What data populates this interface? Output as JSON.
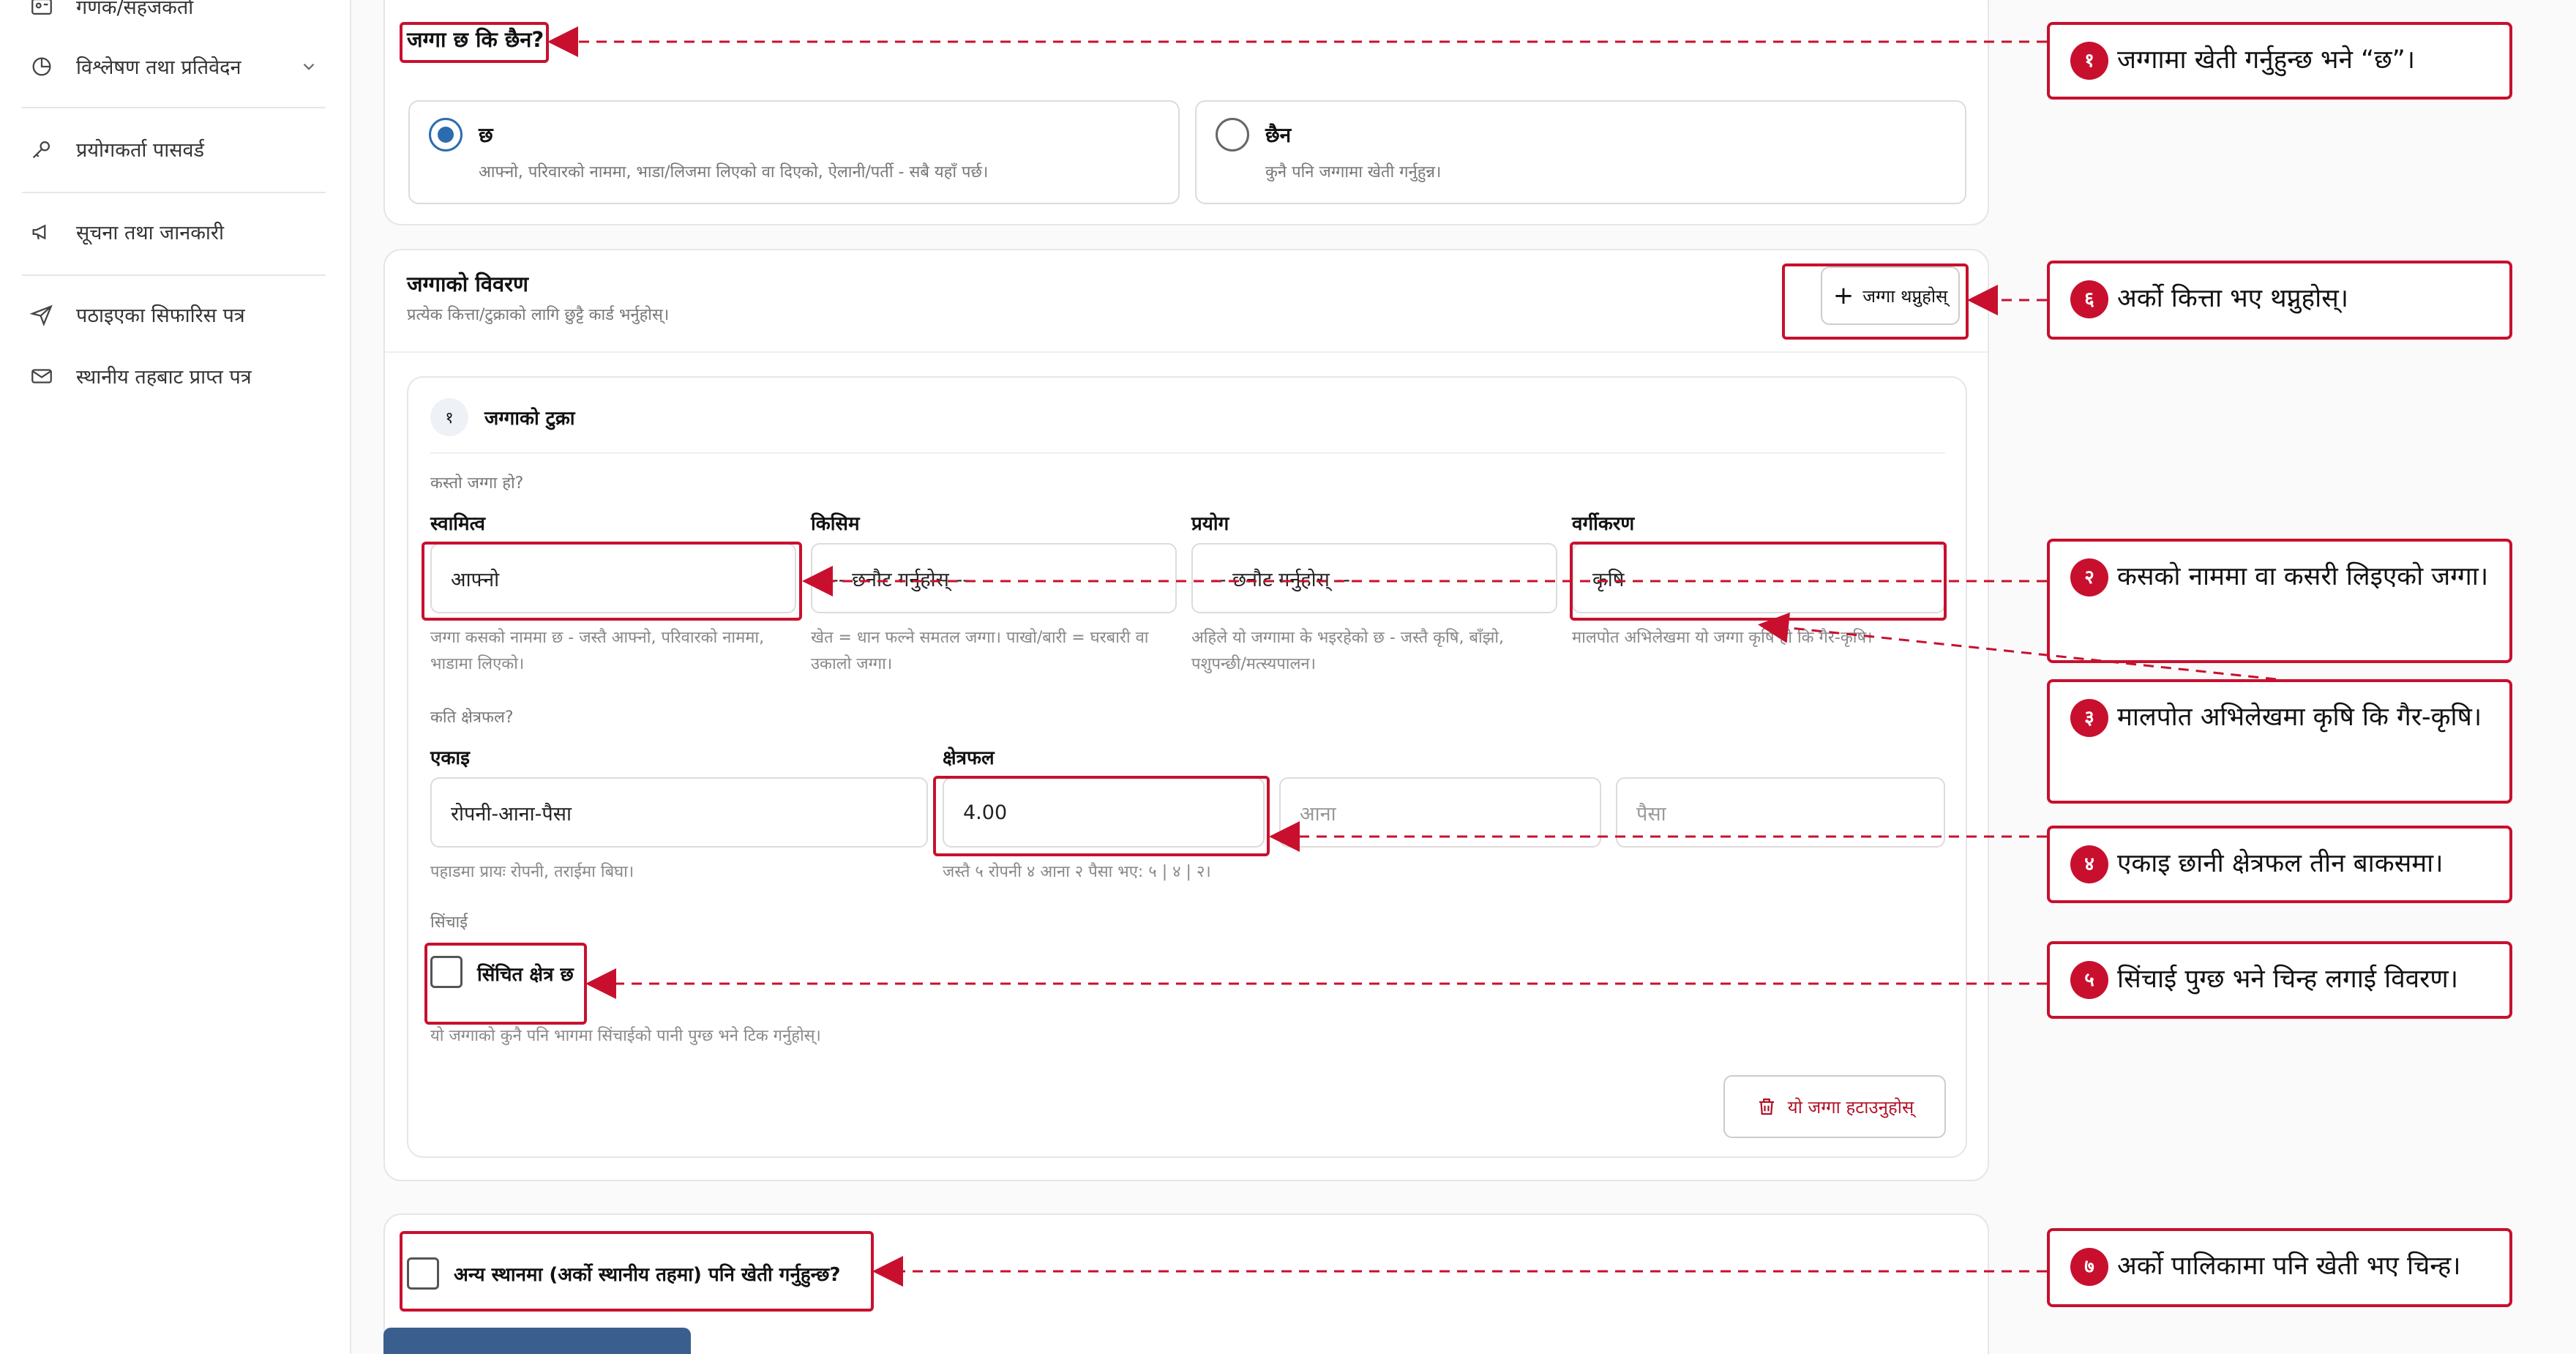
{
  "sidebar": {
    "items": [
      {
        "label": "गणक/सहजकर्ता",
        "icon": "id-card-icon"
      },
      {
        "label": "विश्लेषण तथा प्रतिवेदन",
        "icon": "pie-chart-icon"
      },
      {
        "label": "प्रयोगकर्ता पासवर्ड",
        "icon": "key-icon"
      },
      {
        "label": "सूचना तथा जानकारी",
        "icon": "megaphone-icon"
      },
      {
        "label": "पठाइएका सिफारिस पत्र",
        "icon": "send-icon"
      },
      {
        "label": "स्थानीय तहबाट प्राप्त पत्र",
        "icon": "mail-icon"
      }
    ]
  },
  "land_question": {
    "title": "जग्गा छ कि छैन?",
    "options": [
      {
        "label": "छ",
        "desc": "आफ्नो, परिवारको नाममा, भाडा/लिजमा लिएको वा दिएको, ऐलानी/पर्ती - सबै यहाँ पर्छ।",
        "selected": true
      },
      {
        "label": "छैन",
        "desc": "कुनै पनि जग्गामा खेती गर्नुहुन्न।",
        "selected": false
      }
    ]
  },
  "land_details": {
    "title": "जग्गाको विवरण",
    "subtitle": "प्रत्येक कित्ता/टुक्राको लागि छुट्टै कार्ड भर्नुहोस्।",
    "add_button": "जग्गा थप्नुहोस्",
    "parcel": {
      "index": "१",
      "title": "जग्गाको टुक्रा",
      "what_land": "कस्तो जग्गा हो?",
      "fields": [
        {
          "label": "स्वामित्व",
          "value": "आफ्नो",
          "help": "जग्गा कसको नाममा छ - जस्तै आफ्नो, परिवारको नाममा, भाडामा लिएको।"
        },
        {
          "label": "किसिम",
          "value": "-- छनौट गर्नुहोस् --",
          "help": "खेत = धान फल्ने समतल जग्गा। पाखो/बारी = घरबारी वा उकालो जग्गा।"
        },
        {
          "label": "प्रयोग",
          "value": "-- छनौट गर्नुहोस् --",
          "help": "अहिले यो जग्गामा के भइरहेको छ - जस्तै कृषि, बाँझो, पशुपन्छी/मत्स्यपालन।"
        },
        {
          "label": "वर्गीकरण",
          "value": "कृषि",
          "help": "मालपोत अभिलेखमा यो जग्गा कृषि हो कि गैर-कृषि।"
        }
      ],
      "area_question": "कति क्षेत्रफल?",
      "unit": {
        "label": "एकाइ",
        "value": "रोपनी-आना-पैसा",
        "help": "पहाडमा प्रायः रोपनी, तराईमा बिघा।"
      },
      "area": {
        "label": "क्षेत्रफल",
        "value": "4.00",
        "ana_placeholder": "आना",
        "paisa_placeholder": "पैसा",
        "help": "जस्तै ५ रोपनी ४ आना २ पैसा भए: ५ | ४ | २।"
      },
      "irrigation": {
        "label": "सिंचाई",
        "check_label": "सिंचित क्षेत्र छ",
        "checked": false,
        "help": "यो जग्गाको कुनै पनि भागमा सिंचाईको पानी पुग्छ भने टिक गर्नुहोस्।"
      },
      "remove_button": "यो जग्गा हटाउनुहोस्"
    }
  },
  "other_place": {
    "check_label": "अन्य स्थानमा (अर्को स्थानीय तहमा) पनि खेती गर्नुहुन्छ?",
    "checked": false
  },
  "annotations": [
    {
      "num": "१",
      "text": "जग्गामा खेती गर्नुहुन्छ भने “छ”।"
    },
    {
      "num": "६",
      "text": "अर्को कित्ता भए थप्नुहोस्।"
    },
    {
      "num": "२",
      "text": "कसको नाममा वा कसरी लिइएको जग्गा।"
    },
    {
      "num": "३",
      "text": "मालपोत अभिलेखमा कृषि कि गैर-कृषि।"
    },
    {
      "num": "४",
      "text": "एकाइ छानी क्षेत्रफल तीन बाकसमा।"
    },
    {
      "num": "५",
      "text": "सिंचाई पुग्छ भने चिन्ह लगाई विवरण।"
    },
    {
      "num": "७",
      "text": "अर्को पालिकामा पनि खेती भए चिन्ह।"
    }
  ],
  "colors": {
    "accent": "#c8102e",
    "radio": "#2b6cb0"
  }
}
